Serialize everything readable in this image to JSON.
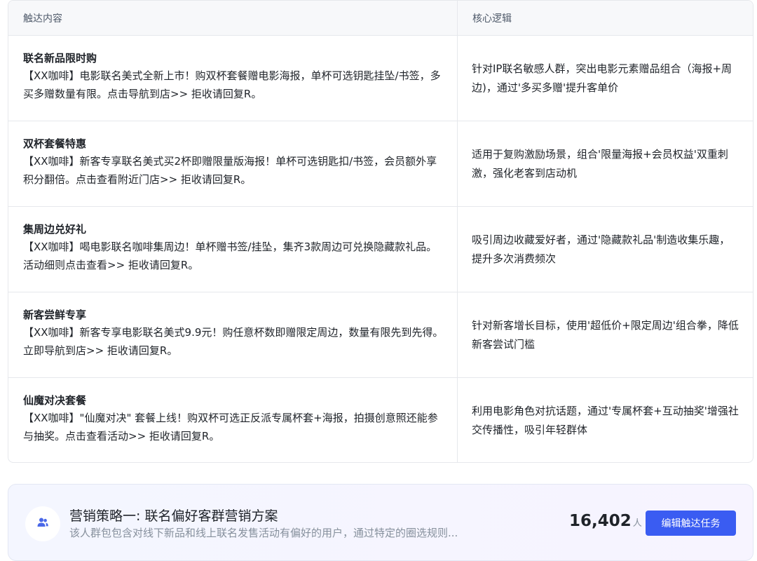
{
  "table": {
    "headers": [
      "触达内容",
      "核心逻辑"
    ],
    "rows": [
      {
        "title": "联名新品限时购",
        "content": "【XX咖啡】电影联名美式全新上市！购双杯套餐赠电影海报，单杯可选钥匙挂坠/书签，多买多赠数量有限。点击导航到店>> 拒收请回复R。",
        "logic": "针对IP联名敏感人群，突出电影元素赠品组合（海报+周边)，通过'多买多赠'提升客单价"
      },
      {
        "title": "双杯套餐特惠",
        "content": "【XX咖啡】新客专享联名美式买2杯即赠限量版海报！单杯可选钥匙扣/书签，会员额外享积分翻倍。点击查看附近门店>> 拒收请回复R。",
        "logic": "适用于复购激励场景，组合'限量海报+会员权益'双重刺激，强化老客到店动机"
      },
      {
        "title": "集周边兑好礼",
        "content": "【XX咖啡】喝电影联名咖啡集周边！单杯赠书签/挂坠，集齐3款周边可兑换隐藏款礼品。活动细则点击查看>> 拒收请回复R。",
        "logic": "吸引周边收藏爱好者，通过'隐藏款礼品'制造收集乐趣，提升多次消费频次"
      },
      {
        "title": "新客尝鲜专享",
        "content": "【XX咖啡】新客专享电影联名美式9.9元！购任意杯数即赠限定周边，数量有限先到先得。立即导航到店>> 拒收请回复R。",
        "logic": "针对新客增长目标，使用'超低价+限定周边'组合拳，降低新客尝试门槛"
      },
      {
        "title": "仙魔对决套餐",
        "content": "【XX咖啡】\"仙魔对决\" 套餐上线！购双杯可选正反派专属杯套+海报，拍摄创意照还能参与抽奖。点击查看活动>> 拒收请回复R。",
        "logic": "利用电影角色对抗话题，通过'专属杯套+互动抽奖'增强社交传播性，吸引年轻群体"
      }
    ]
  },
  "strategy": {
    "icon": "users-icon",
    "title": "营销策略一: 联名偏好客群营销方案",
    "description": "该人群包包含对线下新品和线上联名发售活动有偏好的用户，通过特定的圈选规则...",
    "count": "16,402",
    "count_unit": "人",
    "edit_label": "编辑触达任务"
  },
  "colors": {
    "accent": "#3a5cf2",
    "border": "#e6e8ec",
    "header_bg": "#f7f8fa"
  }
}
